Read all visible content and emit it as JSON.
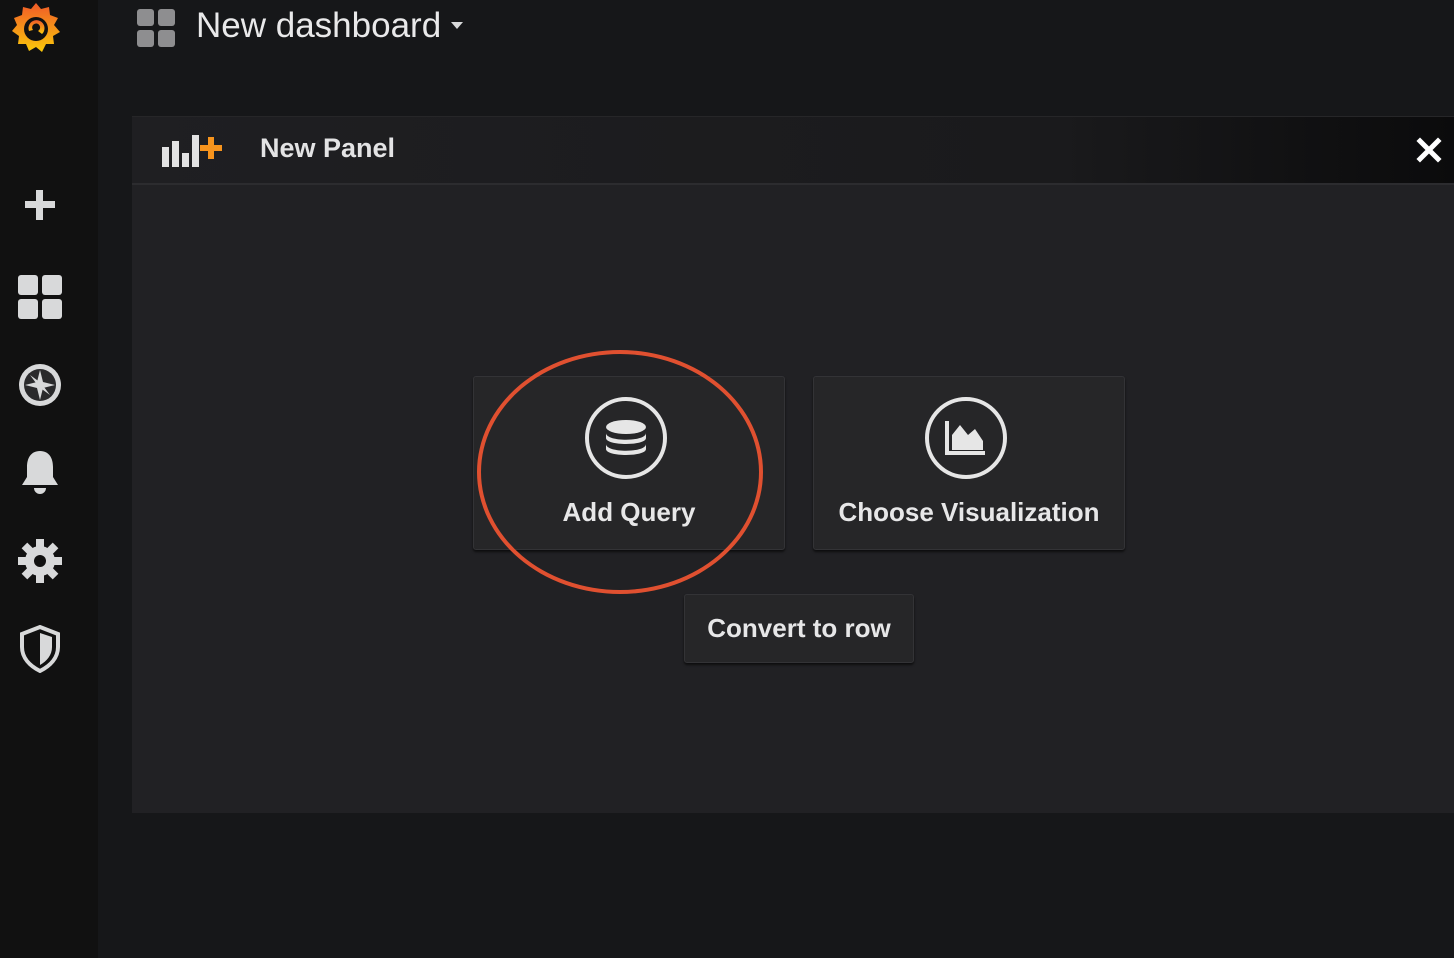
{
  "sidebar": {
    "items": [
      {
        "icon": "grafana-logo-icon"
      },
      {
        "icon": "plus-icon"
      },
      {
        "icon": "dashboards-icon"
      },
      {
        "icon": "explore-compass-icon"
      },
      {
        "icon": "alerting-bell-icon"
      },
      {
        "icon": "configuration-gear-icon"
      },
      {
        "icon": "server-admin-shield-icon"
      }
    ]
  },
  "header": {
    "title": "New dashboard"
  },
  "panel": {
    "title": "New Panel",
    "actions": [
      {
        "label": "Add Query",
        "icon": "database-icon"
      },
      {
        "label": "Choose Visualization",
        "icon": "area-chart-icon"
      }
    ],
    "convert_label": "Convert to row"
  },
  "colors": {
    "accent": "#f7941d",
    "annotation": "#e05030",
    "background": "#161719",
    "panel": "#212124"
  }
}
